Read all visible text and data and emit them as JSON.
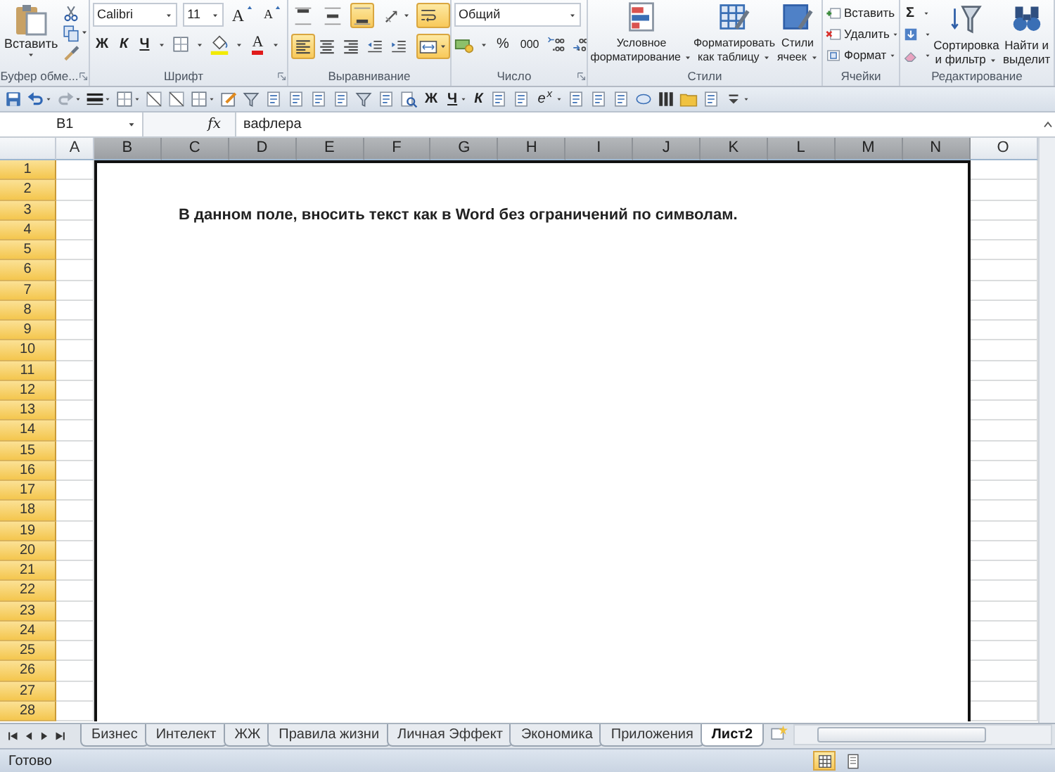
{
  "ribbon": {
    "clipboard": {
      "label": "Буфер обме...",
      "paste": "Вставить"
    },
    "font": {
      "label": "Шрифт",
      "font_name": "Calibri",
      "font_size": "11",
      "grow": "A",
      "shrink": "A",
      "bold": "Ж",
      "italic": "К",
      "underline": "Ч",
      "font_color": "A"
    },
    "alignment": {
      "label": "Выравнивание",
      "row_1": [
        {
          "kind": "top",
          "selected": false
        },
        {
          "kind": "middle",
          "selected": false
        },
        {
          "kind": "bottom",
          "selected": true
        },
        {
          "kind": "orient",
          "selected": false
        }
      ],
      "row_2": [
        {
          "kind": "left",
          "selected": true
        },
        {
          "kind": "center",
          "selected": false
        },
        {
          "kind": "right",
          "selected": false
        },
        {
          "kind": "outdent",
          "selected": false
        },
        {
          "kind": "indent",
          "selected": false
        }
      ],
      "side": [
        {
          "kind": "wrap",
          "selected": true
        },
        {
          "kind": "merge",
          "selected": true
        }
      ]
    },
    "number": {
      "label": "Число",
      "format": "Общий",
      "percent": "%",
      "thousands": "000"
    },
    "styles": {
      "label": "Стили",
      "buttons": [
        {
          "kind": "conditional",
          "label": "Условное форматирование"
        },
        {
          "kind": "table",
          "label": "Форматировать как таблицу"
        },
        {
          "kind": "cell_styles",
          "label": "Стили ячеек"
        }
      ]
    },
    "cells": {
      "label": "Ячейки",
      "items": [
        {
          "kind": "insert",
          "label": "Вставить"
        },
        {
          "kind": "delete",
          "label": "Удалить"
        },
        {
          "kind": "format",
          "label": "Формат"
        }
      ]
    },
    "editing": {
      "label": "Редактирование",
      "autosum": "Σ",
      "sort": "Сортировка и фильтр",
      "find": "Найти и выделит"
    }
  },
  "quick_access": [
    {
      "kind": "save",
      "caret": false
    },
    {
      "kind": "undo",
      "caret": true
    },
    {
      "kind": "redo",
      "caret": true
    },
    {
      "kind": "lines",
      "caret": true
    },
    {
      "kind": "border",
      "caret": true
    },
    {
      "kind": "diagonal",
      "caret": false
    },
    {
      "kind": "diagonal",
      "caret": false
    },
    {
      "kind": "border",
      "caret": true
    },
    {
      "kind": "edit",
      "caret": false
    },
    {
      "kind": "filter",
      "caret": false
    },
    {
      "kind": "generic",
      "caret": false
    },
    {
      "kind": "generic",
      "caret": false
    },
    {
      "kind": "generic",
      "caret": false
    },
    {
      "kind": "generic",
      "caret": false
    },
    {
      "kind": "filter",
      "caret": false
    },
    {
      "kind": "generic",
      "caret": false
    },
    {
      "kind": "preview",
      "caret": false
    },
    {
      "kind": "bold",
      "label": "Ж",
      "caret": false
    },
    {
      "kind": "underline",
      "label": "Ч",
      "caret": true
    },
    {
      "kind": "italic",
      "label": "К",
      "caret": false
    },
    {
      "kind": "generic",
      "caret": false
    },
    {
      "kind": "generic",
      "caret": false
    },
    {
      "kind": "power",
      "label": "e$^{x}$",
      "caret": true
    },
    {
      "kind": "generic",
      "caret": false
    },
    {
      "kind": "generic",
      "caret": false
    },
    {
      "kind": "generic",
      "caret": false
    },
    {
      "kind": "shape",
      "caret": false
    },
    {
      "kind": "columns",
      "caret": false
    },
    {
      "kind": "folder",
      "caret": false
    },
    {
      "kind": "generic",
      "caret": false
    },
    {
      "kind": "more",
      "caret": true
    }
  ],
  "formula_bar": {
    "name_box": "B1",
    "fx": "fx",
    "value": "вафлера"
  },
  "columns": [
    {
      "label": "A",
      "selected": false
    },
    {
      "label": "B",
      "selected": true
    },
    {
      "label": "C",
      "selected": true
    },
    {
      "label": "D",
      "selected": true
    },
    {
      "label": "E",
      "selected": true
    },
    {
      "label": "F",
      "selected": true
    },
    {
      "label": "G",
      "selected": true
    },
    {
      "label": "H",
      "selected": true
    },
    {
      "label": "I",
      "selected": true
    },
    {
      "label": "J",
      "selected": true
    },
    {
      "label": "K",
      "selected": true
    },
    {
      "label": "L",
      "selected": true
    },
    {
      "label": "M",
      "selected": true
    },
    {
      "label": "N",
      "selected": true
    },
    {
      "label": "O",
      "selected": false
    }
  ],
  "rows": [
    {
      "label": "1",
      "selected": true
    },
    {
      "label": "2",
      "selected": true
    },
    {
      "label": "3",
      "selected": true
    },
    {
      "label": "4",
      "selected": true
    },
    {
      "label": "5",
      "selected": true
    },
    {
      "label": "6",
      "selected": true
    },
    {
      "label": "7",
      "selected": true
    },
    {
      "label": "8",
      "selected": true
    },
    {
      "label": "9",
      "selected": true
    },
    {
      "label": "10",
      "selected": true
    },
    {
      "label": "11",
      "selected": true
    },
    {
      "label": "12",
      "selected": true
    },
    {
      "label": "13",
      "selected": true
    },
    {
      "label": "14",
      "selected": true
    },
    {
      "label": "15",
      "selected": true
    },
    {
      "label": "16",
      "selected": true
    },
    {
      "label": "17",
      "selected": true
    },
    {
      "label": "18",
      "selected": true
    },
    {
      "label": "19",
      "selected": true
    },
    {
      "label": "20",
      "selected": true
    },
    {
      "label": "21",
      "selected": true
    },
    {
      "label": "22",
      "selected": true
    },
    {
      "label": "23",
      "selected": true
    },
    {
      "label": "24",
      "selected": true
    },
    {
      "label": "25",
      "selected": true
    },
    {
      "label": "26",
      "selected": true
    },
    {
      "label": "27",
      "selected": true
    },
    {
      "label": "28",
      "selected": true
    }
  ],
  "merged_cell": {
    "text": "В данном поле, вносить текст как в Word без ограничений по символам."
  },
  "sheet_tabs": [
    {
      "label": "Бизнес",
      "selected": false
    },
    {
      "label": "Интелект",
      "selected": false
    },
    {
      "label": "ЖЖ",
      "selected": false
    },
    {
      "label": "Правила жизни",
      "selected": false
    },
    {
      "label": "Личная Эффект",
      "selected": false
    },
    {
      "label": "Экономика",
      "selected": false
    },
    {
      "label": "Приложения",
      "selected": false
    },
    {
      "label": "Лист2",
      "selected": true
    }
  ],
  "status_bar": {
    "text": "Готово",
    "views": [
      {
        "kind": "normal",
        "selected": true
      },
      {
        "kind": "layout",
        "selected": false
      }
    ]
  }
}
